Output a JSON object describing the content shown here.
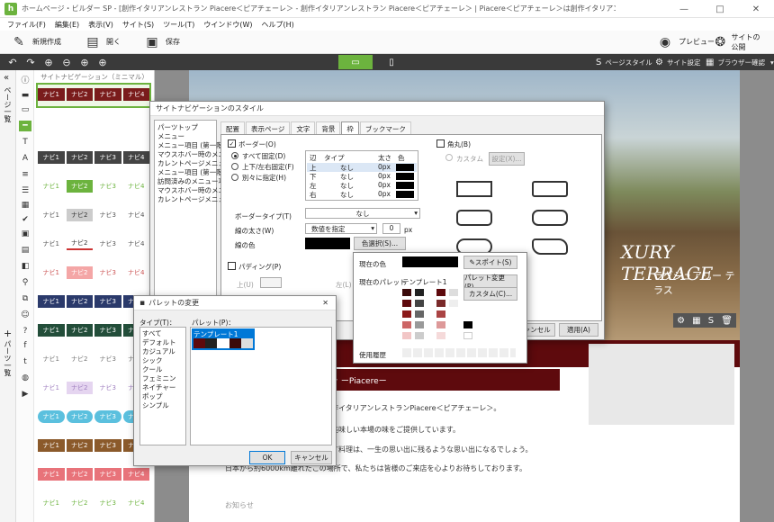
{
  "window": {
    "title": "ホームページ・ビルダー SP - [創作イタリアンレストラン Piacere＜ピアチェーレ＞ - 創作イタリアンレストラン Piacere＜ピアチェーレ＞ | Piacere＜ピアチェーレ＞は創作イタリアンレストランです。*]",
    "min": "—",
    "max": "□",
    "close": "✕"
  },
  "menu": [
    "ファイル(F)",
    "編集(E)",
    "表示(V)",
    "サイト(S)",
    "ツール(T)",
    "ウインドウ(W)",
    "ヘルプ(H)"
  ],
  "toolbar": {
    "new": "新規作成",
    "open": "開く",
    "save": "保存",
    "preview": "プレビュー",
    "publish": "サイトの公開"
  },
  "toolbar2": {
    "page_style": "ページスタイル",
    "site_settings": "サイト設定",
    "browser_check": "ブラウザー確認"
  },
  "left_strip": {
    "page_list": "ページ一覧",
    "parts": "パーツ一覧"
  },
  "nav_panel": {
    "title": "サイトナビゲーション（ミニマル）",
    "labels": [
      "ナビ1",
      "ナビ2",
      "ナビ3",
      "ナビ4"
    ]
  },
  "hero": {
    "title": "XURY TERRACE",
    "subtitle": "ラグジュアリー テラス"
  },
  "content": {
    "heading": "ッ ーPiacereー",
    "line1": "、創作イタリアンレストランPiacere＜ピアチェーレ＞。",
    "line2": "様に美味しい本場の味をご提供しています。",
    "line3": "り出す料理は、一生の思い出に残るような思い出になるでしょう。",
    "line4": "日本から約6000km離れたこの場所で、私たちは皆様のご来店を心よりお待ちしております。",
    "news": "お知らせ"
  },
  "style_dialog": {
    "title": "サイトナビゲーションのスタイル",
    "list": [
      "パーツトップ",
      "メニュー",
      "メニュー項目 (第一階層)",
      "マウスホバー時のメニュー項目",
      "カレントページメニュー項目",
      "メニュー項目 (第一階層)",
      "訪問済みのメニュー項目",
      "マウスホバー時のメニュー",
      "カレントページメニュー項目"
    ],
    "tabs": [
      "配置",
      "表示ページ",
      "文字",
      "背景",
      "枠",
      "ブックマーク"
    ],
    "border_label": "ボーダー(O)",
    "fixed_all": "すべて固定(D)",
    "top_bottom": "上下/左右固定(F)",
    "individual": "別々に指定(H)",
    "table_head": [
      "辺",
      "タイプ",
      "太さ",
      "色"
    ],
    "table_rows": [
      [
        "上",
        "なし",
        "0px"
      ],
      [
        "下",
        "なし",
        "0px"
      ],
      [
        "左",
        "なし",
        "0px"
      ],
      [
        "右",
        "なし",
        "0px"
      ]
    ],
    "border_type_label": "ボーダータイプ(T)",
    "border_type": "なし",
    "line_width_label": "線の太さ(W)",
    "line_width": "数値を指定",
    "line_width_num": "0",
    "px": "px",
    "line_color_label": "線の色",
    "color_select": "色選択(S)...",
    "padding_label": "パディング(P)",
    "pad_top": "上(U)",
    "pad_left": "左(L)",
    "corner_label": "角丸(B)",
    "custom": "カスタム",
    "setting": "設定(X)...",
    "cancel": "キャンセル",
    "apply": "適用(A)"
  },
  "color_popup": {
    "current_color": "現在の色",
    "eyedropper": "スポイト(S)",
    "current_palette": "現在のパレット",
    "palette_name": "テンプレート1",
    "change_palette": "パレット変更(P)...",
    "custom": "カスタム(C)...",
    "history": "使用履歴"
  },
  "palette_dialog": {
    "title": "パレットの変更",
    "type_label": "タイプ(T)：",
    "types": [
      "すべて",
      "デフォルト",
      "カジュアル",
      "シック",
      "クール",
      "フェミニン",
      "ネイチャー",
      "ポップ",
      "シンプル"
    ],
    "palette_label": "パレット(P)：",
    "selected": "テンプレート1",
    "ok": "OK",
    "cancel": "キャンセル"
  },
  "colors": {
    "accent_green": "#6cb33e",
    "dark_red": "#5e0a0d",
    "select_blue": "#0078d7"
  }
}
